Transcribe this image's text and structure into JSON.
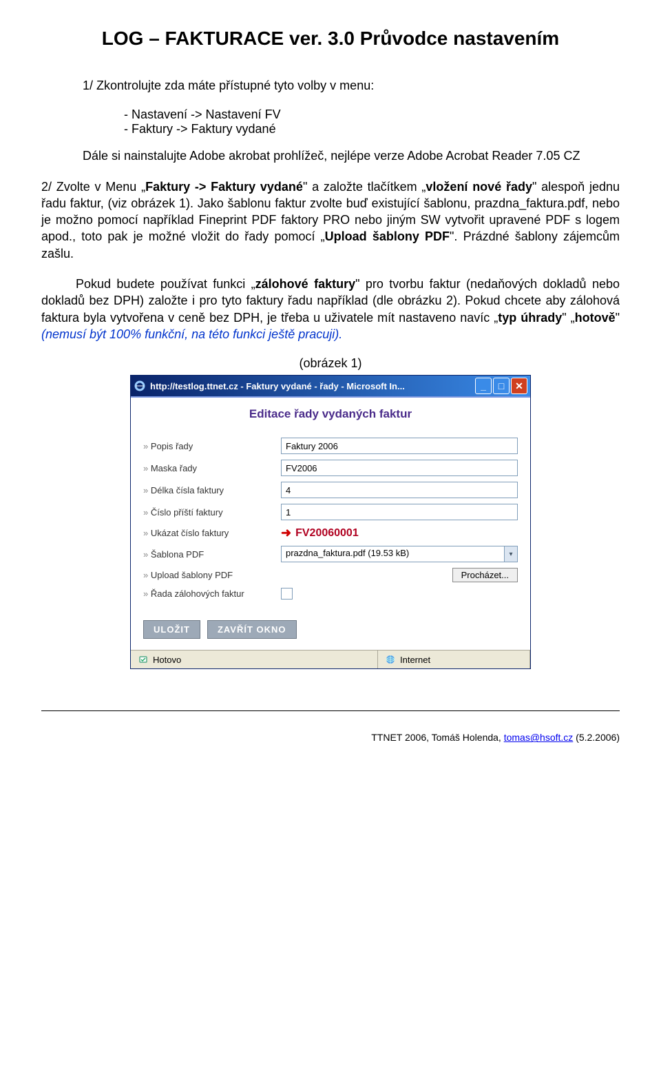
{
  "title": "LOG – FAKTURACE ver. 3.0 Průvodce nastavením",
  "section1": {
    "lead": "1/    Zkontrolujte zda máte přístupné tyto volby v menu:",
    "b1": "Nastavení -> Nastavení FV",
    "b2": "Faktury -> Faktury vydané",
    "para2": "Dále si nainstalujte Adobe akrobat prohlížeč, nejlépe verze Adobe Acrobat Reader 7.05 CZ"
  },
  "section2": {
    "p1a": "2/    Zvolte v Menu „",
    "p1b": "Faktury -> Faktury vydané",
    "p1c": "\" a založte tlačítkem „",
    "p1d": "vložení nové řady",
    "p1e": "\" alespoň jednu řadu faktur, (viz obrázek 1). Jako šablonu faktur zvolte buď existující šablonu, prazdna_faktura.pdf, nebo je možno pomocí například Fineprint PDF faktory PRO nebo jiným SW vytvořit upravené PDF s logem apod., toto pak je možné vložit do řady pomocí „",
    "p1f": "Upload šablony PDF",
    "p1g": "\". Prázdné šablony zájemcům zašlu.",
    "p2a": "Pokud budete používat funkci „",
    "p2b": "zálohové faktury",
    "p2c": "\" pro tvorbu faktur (nedaňových dokladů nebo dokladů bez DPH) založte i pro tyto faktury řadu například (dle obrázku 2). Pokud chcete aby zálohová faktura byla vytvořena v ceně bez DPH, je třeba u uživatele mít nastaveno navíc „",
    "p2d": "typ úhrady",
    "p2e": "\" „",
    "p2f": "hotově",
    "p2g": "\" ",
    "p2h": "(nemusí být 100% funkční, na této funkci ještě pracuji)."
  },
  "obr1_label": "(obrázek 1)",
  "win": {
    "title": "http://testlog.ttnet.cz - Faktury vydané - řady - Microsoft In...",
    "form_title": "Editace řady vydaných faktur",
    "labels": {
      "popis": "Popis řady",
      "maska": "Maska řady",
      "delka": "Délka čísla faktury",
      "cislo": "Číslo příští faktury",
      "ukazat": "Ukázat číslo faktury",
      "sablona": "Šablona PDF",
      "upload": "Upload šablony PDF",
      "rada": "Řada zálohových faktur"
    },
    "values": {
      "popis": "Faktury 2006",
      "maska": "FV2006",
      "delka": "4",
      "cislo": "1",
      "ukazat": "FV20060001",
      "sablona": "prazdna_faktura.pdf (19.53 kB)"
    },
    "browse": "Procházet...",
    "btn_save": "ULOŽIT",
    "btn_close": "ZAVŘÍT OKNO",
    "status_done": "Hotovo",
    "status_zone": "Internet"
  },
  "footer": {
    "text1": "TTNET 2006, Tomáš Holenda, ",
    "email": "tomas@hsoft.cz",
    "text2": " (5.2.2006)"
  }
}
